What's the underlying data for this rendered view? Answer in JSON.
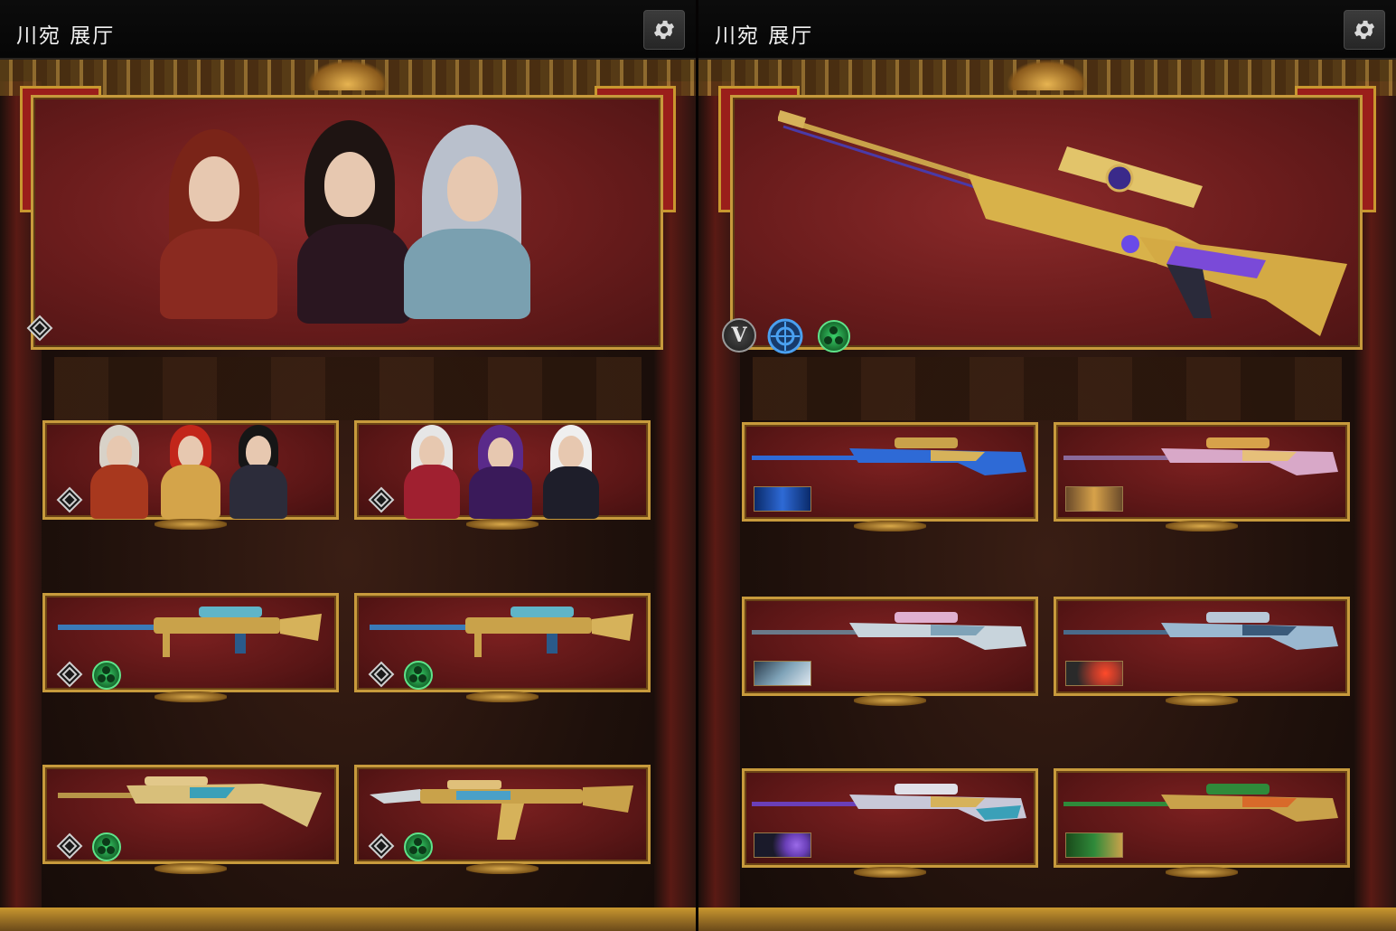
{
  "left_panel": {
    "title": "川宛 展厅",
    "settings_icon": "gear-icon",
    "hero": {
      "icons": [
        "rank-emblem-icon"
      ]
    },
    "cards": [
      {
        "icons": [
          "rank-emblem-icon"
        ]
      },
      {
        "icons": [
          "rank-emblem-icon"
        ]
      },
      {
        "icons": [
          "rank-emblem-icon",
          "green-perk-icon"
        ]
      },
      {
        "icons": [
          "rank-emblem-icon",
          "green-perk-icon"
        ]
      },
      {
        "icons": [
          "rank-emblem-icon",
          "green-perk-icon"
        ]
      },
      {
        "icons": [
          "rank-emblem-icon",
          "green-perk-icon"
        ]
      }
    ]
  },
  "right_panel": {
    "title": "川宛 展厅",
    "settings_icon": "gear-icon",
    "hero": {
      "badge_letter": "V",
      "icons": [
        "v-badge-icon",
        "crosshair-icon",
        "green-perk-icon"
      ]
    },
    "cards": [
      {
        "thumb_color": "#2e6ad6"
      },
      {
        "thumb_color": "#d7a24a"
      },
      {
        "thumb_color": "#7fa3b8"
      },
      {
        "thumb_color": "#b23a2a"
      },
      {
        "thumb_color": "#6a3fb8"
      },
      {
        "thumb_color": "#2f8a3a"
      }
    ]
  },
  "colors": {
    "frame_gold": "#c79a3c",
    "card_red": "#6a1c1c",
    "perk_green": "#3ad16a",
    "crosshair_blue": "#2f7fd6"
  }
}
